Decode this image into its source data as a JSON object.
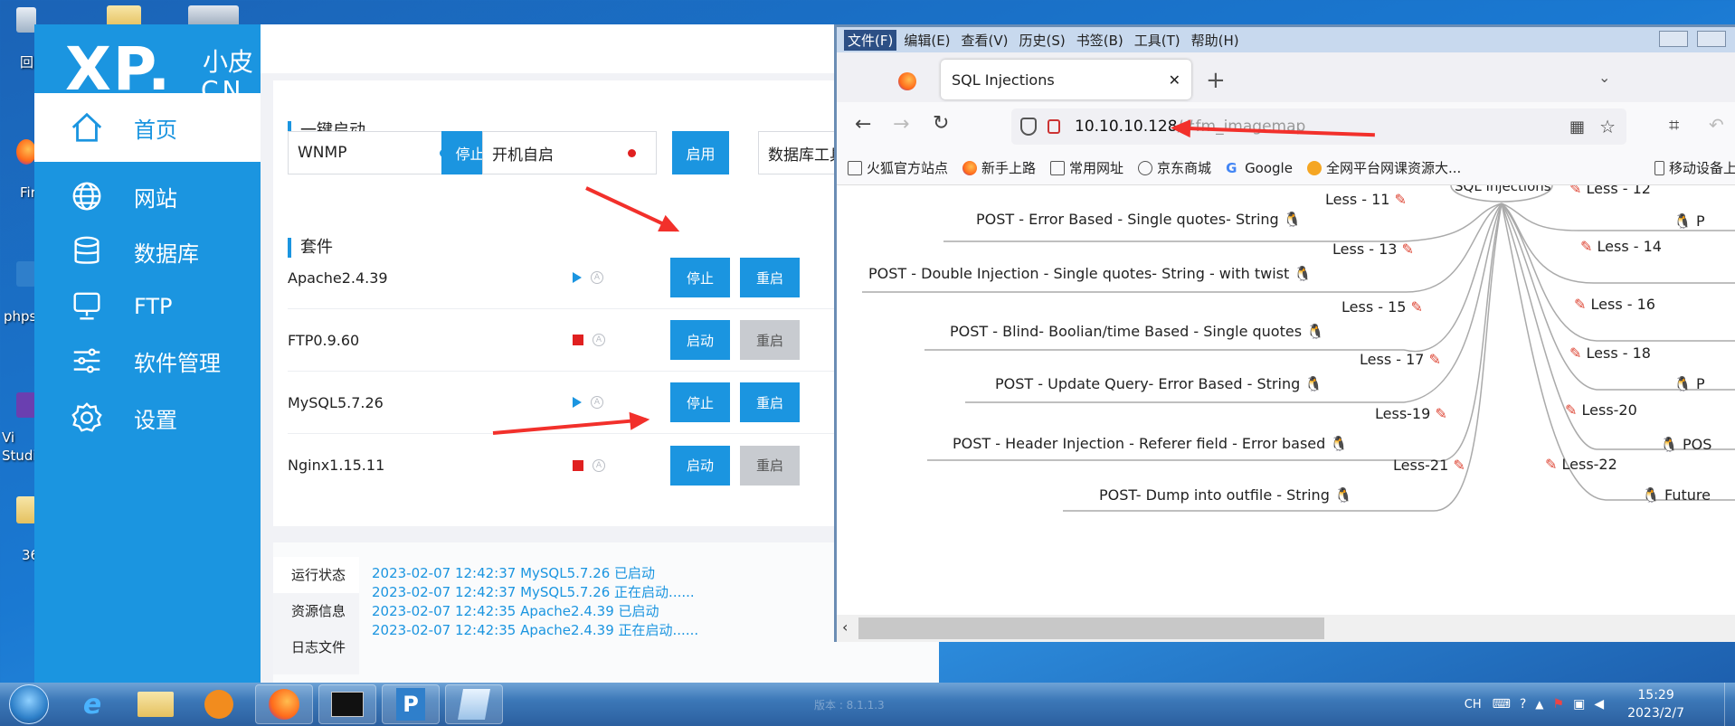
{
  "desktop": {
    "icons": [
      {
        "label": "回",
        "name": "recycle-bin"
      },
      {
        "label": "Fir",
        "name": "firefox"
      },
      {
        "label": "phps",
        "name": "phpstudy"
      },
      {
        "label": "Vi\nStudi",
        "name": "visual-studio"
      },
      {
        "label": "36",
        "name": "folder-360"
      }
    ]
  },
  "xp_app": {
    "logo": {
      "main": "XP.",
      "cn_top": "小皮",
      "cn_bottom": "CN"
    },
    "nav": [
      {
        "label": "首页",
        "icon": "home-icon",
        "active": true
      },
      {
        "label": "网站",
        "icon": "globe-icon",
        "active": false
      },
      {
        "label": "数据库",
        "icon": "database-icon",
        "active": false
      },
      {
        "label": "FTP",
        "icon": "monitor-icon",
        "active": false
      },
      {
        "label": "软件管理",
        "icon": "sliders-icon",
        "active": false
      },
      {
        "label": "设置",
        "icon": "gear-icon",
        "active": false
      }
    ],
    "quick_start": {
      "title": "一键启动",
      "wnmp_label": "WNMP",
      "wnmp_button": "停止",
      "autostart_label": "开机自启",
      "autostart_button": "启用",
      "db_tool_label": "数据库工具"
    },
    "suite": {
      "title": "套件",
      "rows": [
        {
          "name": "Apache2.4.39",
          "status": "running",
          "btn1": "停止",
          "btn2": "重启",
          "btn2_disabled": false
        },
        {
          "name": "FTP0.9.60",
          "status": "stopped",
          "btn1": "启动",
          "btn2": "重启",
          "btn2_disabled": true
        },
        {
          "name": "MySQL5.7.26",
          "status": "running",
          "btn1": "停止",
          "btn2": "重启",
          "btn2_disabled": false
        },
        {
          "name": "Nginx1.15.11",
          "status": "stopped",
          "btn1": "启动",
          "btn2": "重启",
          "btn2_disabled": true
        }
      ]
    },
    "log": {
      "tabs": [
        "运行状态",
        "资源信息",
        "日志文件"
      ],
      "lines": [
        "2023-02-07 12:42:37 MySQL5.7.26 已启动",
        "2023-02-07 12:42:37 MySQL5.7.26 正在启动......",
        "2023-02-07 12:42:35 Apache2.4.39 已启动",
        "2023-02-07 12:42:35 Apache2.4.39 正在启动......"
      ]
    },
    "status_color_running": "#1b95e0",
    "status_color_stopped": "#e02020"
  },
  "firefox": {
    "menu": [
      "文件(F)",
      "编辑(E)",
      "查看(V)",
      "历史(S)",
      "书签(B)",
      "工具(T)",
      "帮助(H)"
    ],
    "tab_title": "SQL Injections",
    "url_host": "10.10.10.128",
    "url_rest": "/#fm_imagemap",
    "bookmarks": [
      "火狐官方站点",
      "新手上路",
      "常用网址",
      "京东商城",
      "Google",
      "全网平台网课资源大..."
    ],
    "bookmarks_right": "移动设备上",
    "mindmap": {
      "center": "SQL Injections",
      "left": [
        {
          "less": "Less - 11",
          "desc": "POST - Error Based - Single quotes- String"
        },
        {
          "less": "Less - 13",
          "desc": "POST - Double Injection - Single quotes- String - with twist"
        },
        {
          "less": "Less - 15",
          "desc": "POST - Blind- Boolian/time Based - Single quotes"
        },
        {
          "less": "Less - 17",
          "desc": "POST - Update Query- Error Based - String"
        },
        {
          "less": "Less-19",
          "desc": "POST - Header Injection - Referer field - Error based"
        },
        {
          "less": "Less-21",
          "desc": "POST- Dump into outfile - String"
        }
      ],
      "right": [
        {
          "less": "Less - 12",
          "desc": "P"
        },
        {
          "less": "Less - 14",
          "desc": ""
        },
        {
          "less": "Less - 16",
          "desc": ""
        },
        {
          "less": "Less - 18",
          "desc": "P"
        },
        {
          "less": "Less-20",
          "desc": "POS"
        },
        {
          "less": "Less-22",
          "desc": "Future"
        }
      ]
    }
  },
  "taskbar": {
    "apps": [
      "start",
      "ie",
      "explorer",
      "media-player",
      "firefox",
      "cmd",
      "phpstudy",
      "notepad"
    ],
    "lang": "CH",
    "time": "15:29",
    "date": "2023/2/7",
    "ghost_text": "版本 : 8.1.1.3"
  },
  "annotation_color": "#f2302b"
}
